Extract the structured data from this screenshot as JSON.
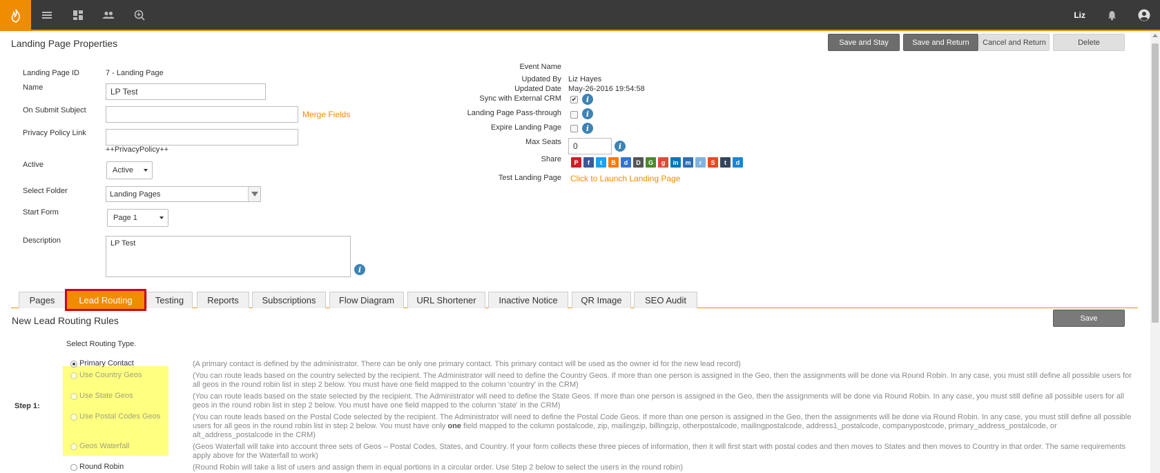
{
  "topbar": {
    "user_name": "Liz",
    "icons": [
      "flame-logo-icon",
      "menu-icon",
      "dashboard-icon",
      "people-icon",
      "add-search-icon",
      "bell-icon",
      "account-icon"
    ]
  },
  "page_title": "Landing Page Properties",
  "actions": {
    "save_stay": "Save and Stay",
    "save_return": "Save and Return",
    "cancel_return": "Cancel and Return",
    "delete": "Delete"
  },
  "left_form": {
    "id_label": "Landing Page ID",
    "id_value": "7  - Landing Page",
    "name_label": "Name",
    "name_value": "LP Test",
    "submit_label": "On Submit Subject",
    "submit_value": "",
    "merge_fields": "Merge Fields",
    "privacy_label": "Privacy Policy Link",
    "privacy_value": "",
    "privacy_hint": "++PrivacyPolicy++",
    "active_label": "Active",
    "active_value": "Active",
    "folder_label": "Select Folder",
    "folder_value": "Landing Pages",
    "start_label": "Start Form",
    "start_value": "Page 1",
    "desc_label": "Description",
    "desc_value": "LP Test"
  },
  "right_form": {
    "event_label": "Event Name",
    "event_value": "",
    "updated_by_label": "Updated By",
    "updated_by_value": "Liz Hayes",
    "updated_date_label": "Updated Date",
    "updated_date_value": "May-26-2016 19:54:58",
    "sync_label": "Sync with External CRM",
    "sync_checked": true,
    "passthrough_label": "Landing Page Pass-through",
    "passthrough_checked": false,
    "expire_label": "Expire Landing Page",
    "expire_checked": false,
    "max_seats_label": "Max Seats",
    "max_seats_value": "0",
    "share_label": "Share",
    "share_icons": [
      {
        "name": "pinterest-icon",
        "color": "#cb2027",
        "glyph": "P"
      },
      {
        "name": "facebook-icon",
        "color": "#3b5998",
        "glyph": "f"
      },
      {
        "name": "twitter-icon",
        "color": "#1da1f2",
        "glyph": "t"
      },
      {
        "name": "blogger-icon",
        "color": "#f57d00",
        "glyph": "B"
      },
      {
        "name": "delicious-icon",
        "color": "#3274d1",
        "glyph": "d"
      },
      {
        "name": "digg-icon",
        "color": "#555555",
        "glyph": "D"
      },
      {
        "name": "google-icon",
        "color": "#4a8a2a",
        "glyph": "G"
      },
      {
        "name": "googleplus-icon",
        "color": "#dd4b39",
        "glyph": "g"
      },
      {
        "name": "linkedin-icon",
        "color": "#0077b5",
        "glyph": "in"
      },
      {
        "name": "myspace-icon",
        "color": "#2f6eb5",
        "glyph": "m"
      },
      {
        "name": "reddit-icon",
        "color": "#7fb3e0",
        "glyph": "r"
      },
      {
        "name": "stumbleupon-icon",
        "color": "#eb4924",
        "glyph": "S"
      },
      {
        "name": "tumblr-icon",
        "color": "#35465c",
        "glyph": "t"
      },
      {
        "name": "delicious-alt-icon",
        "color": "#1b86d2",
        "glyph": "d"
      }
    ],
    "test_label": "Test Landing Page",
    "test_link": "Click to Launch Landing Page"
  },
  "tabs": [
    "Pages",
    "Lead Routing",
    "Testing",
    "Reports",
    "Subscriptions",
    "Flow Diagram",
    "URL Shortener",
    "Inactive Notice",
    "QR Image",
    "SEO Audit"
  ],
  "routing": {
    "title": "New Lead Routing Rules",
    "save": "Save",
    "select_type": "Select Routing Type.",
    "step1": "Step 1:",
    "options": [
      {
        "label": "Primary Contact",
        "selected": true,
        "enabled": true,
        "desc": "(A primary contact is defined by the administrator. There can be only one primary contact. This primary contact will be used as the owner id for the new lead record)"
      },
      {
        "label": "Use Country Geos",
        "selected": false,
        "enabled": false,
        "desc": "(You can route leads based on the country selected by the recipient. The Administrator will need to define the Country Geos. If more than one person is assigned in the Geo, then the assignments will be done via Round Robin. In any case, you must still define all possible users for all geos in the round robin list in step 2 below. You must have one field mapped to the column 'country' in the CRM)"
      },
      {
        "label": "Use State Geos",
        "selected": false,
        "enabled": false,
        "desc": "(You can route leads based on the state selected by the recipient. The Administrator will need to define the State Geos. If more than one person is assigned in the Geo, then the assignments will be done via Round Robin. In any case, you must still define all possible users for all geos in the round robin list in step 2 below. You must have one field mapped to the column 'state' in the CRM)"
      },
      {
        "label": "Use Postal Codes Geos",
        "selected": false,
        "enabled": false,
        "desc_a": "(You can route leads based on the Postal Code selected by the recipient. The Administrator will need to define the Postal Code Geos. If more than one person is assigned in the Geo, then the assignments will be done via Round Robin. In any case, you must still define all possible users for all geos in the round robin list in step 2 below. You must have only ",
        "desc_bold": "one",
        "desc_b": " field mapped to the column postalcode, zip, mailingzip, billingzip, otherpostalcode, mailingpostalcode, address1_postalcode, companypostcode, primary_address_postalcode, or alt_address_postalcode in the CRM)"
      },
      {
        "label": "Geos Waterfall",
        "selected": false,
        "enabled": false,
        "desc": "(Geos Waterfall will take into account three sets of Geos – Postal Codes, States, and Country. If your form collects these three pieces of information, then it will first start with postal codes and then moves to States and then moves to Country in that order. The same requirements apply above for the Waterfall to work)"
      },
      {
        "label": "Round Robin",
        "selected": false,
        "enabled": true,
        "desc": "(Round Robin will take a list of users and assign them in equal portions in a circular order. Use Step 2 below to select the users in the round robin)"
      }
    ]
  }
}
